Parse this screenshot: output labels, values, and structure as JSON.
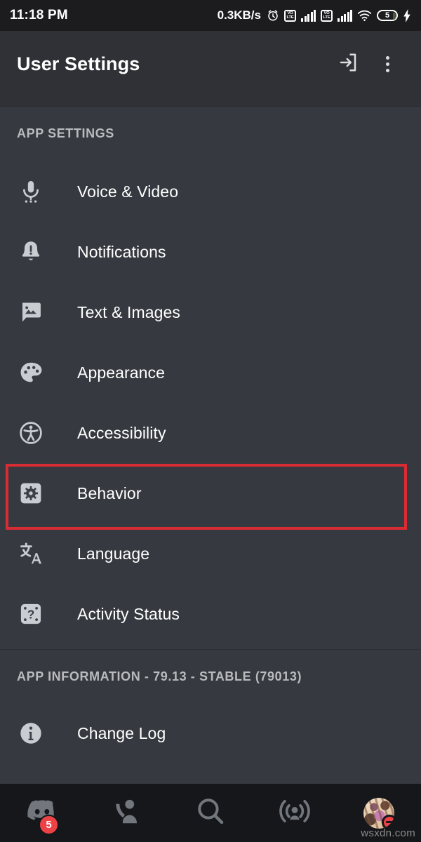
{
  "statusbar": {
    "time": "11:18 PM",
    "network_speed": "0.3KB/s",
    "alarm_icon": "alarm-clock-icon",
    "sim1_label_top": "VO",
    "sim1_label_bottom": "LTE",
    "sim2_label_top": "VO",
    "sim2_label_bottom": "LTE",
    "wifi_icon": "wifi-icon",
    "battery_percent": "5",
    "charging_icon": "lightning-bolt-icon"
  },
  "appbar": {
    "title": "User Settings",
    "logout_icon": "logout-icon",
    "overflow_icon": "overflow-menu-icon"
  },
  "app_settings": {
    "header": "APP SETTINGS",
    "items": [
      {
        "label": "Voice & Video",
        "icon": "microphone-icon"
      },
      {
        "label": "Notifications",
        "icon": "bell-alert-icon"
      },
      {
        "label": "Text & Images",
        "icon": "chat-image-icon"
      },
      {
        "label": "Appearance",
        "icon": "palette-icon"
      },
      {
        "label": "Accessibility",
        "icon": "accessibility-icon"
      },
      {
        "label": "Behavior",
        "icon": "gear-square-icon"
      },
      {
        "label": "Language",
        "icon": "translate-icon"
      },
      {
        "label": "Activity Status",
        "icon": "activity-status-icon"
      }
    ]
  },
  "app_information": {
    "header": "APP INFORMATION - 79.13 - STABLE (79013)",
    "items": [
      {
        "label": "Change Log",
        "icon": "info-icon"
      }
    ]
  },
  "highlight": {
    "target_label": "Behavior",
    "color": "#d92b34"
  },
  "bottom_nav": {
    "items": [
      {
        "name": "home",
        "icon": "discord-home-icon",
        "badge": "5"
      },
      {
        "name": "friends",
        "icon": "friends-icon",
        "badge": ""
      },
      {
        "name": "search",
        "icon": "search-icon",
        "badge": ""
      },
      {
        "name": "stage",
        "icon": "broadcast-icon",
        "badge": ""
      },
      {
        "name": "profile",
        "icon": "avatar-icon",
        "badge": ""
      }
    ],
    "status_indicator": "do-not-disturb"
  },
  "watermark": {
    "text": "wsxdn.com"
  },
  "colors": {
    "background": "#36393f",
    "appbar": "#2f3136",
    "bottom_nav": "#16171a",
    "accent_red": "#ed4245",
    "highlight_red": "#d92b34",
    "text_primary": "#ffffff",
    "text_muted": "#b9bbbe",
    "icon": "#c9ccd1"
  }
}
